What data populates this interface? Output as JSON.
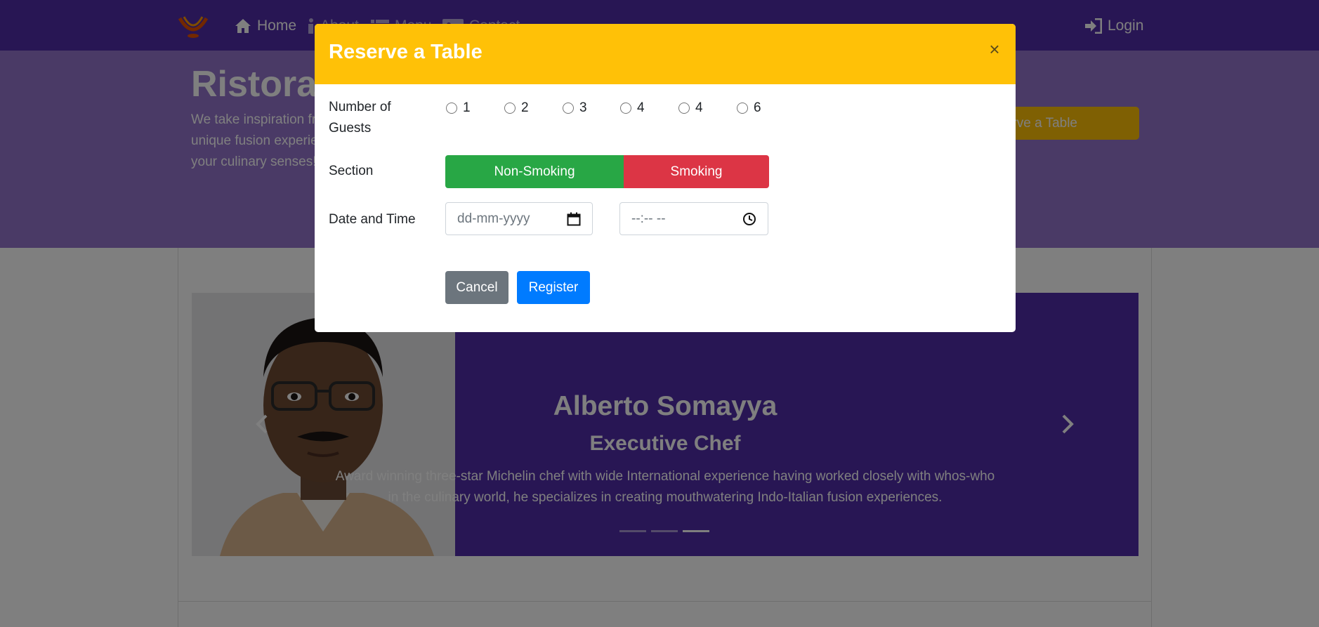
{
  "navbar": {
    "home_label": "Home",
    "about_label": "About",
    "menu_label": "Menu",
    "contact_label": "Contact",
    "login_label": "Login"
  },
  "jumbotron": {
    "title": "Ristorante Con Fusion",
    "text": "We take inspiration from the World's best cuisines, and create a unique fusion experience. Our lipsmacking creations will tickle your culinary senses!",
    "reserve_button_label": "Reserve a Table"
  },
  "carousel": {
    "name": "Alberto Somayya",
    "role": "Executive Chef",
    "description": "Award winning three-star Michelin chef with wide International experience having worked closely with whos-who in the culinary world, he specializes in creating mouthwatering Indo-Italian fusion experiences.",
    "indicators": 3,
    "active_indicator": 3
  },
  "modal": {
    "title": "Reserve a Table",
    "close_label": "×",
    "guests": {
      "label": "Number of Guests",
      "options": [
        "1",
        "2",
        "3",
        "4",
        "4",
        "6"
      ]
    },
    "section": {
      "label": "Section",
      "options": [
        "Non-Smoking",
        "Smoking"
      ]
    },
    "date_time": {
      "label": "Date and Time",
      "date_placeholder": "dd-mm-yyyy",
      "time_placeholder": "--:-- --"
    },
    "cancel_label": "Cancel",
    "register_label": "Register"
  },
  "colors": {
    "primary": "#512da8",
    "light_primary": "#9575cd",
    "warning": "#ffc107",
    "success": "#28a745",
    "danger": "#dc3545",
    "secondary": "#6c757d",
    "blue": "#007bff"
  },
  "icons": [
    "logo-icon",
    "home-icon",
    "info-icon",
    "list-icon",
    "address-card-icon",
    "sign-in-icon",
    "close-icon",
    "calendar-icon",
    "clock-icon",
    "chevron-left-icon",
    "chevron-right-icon"
  ]
}
